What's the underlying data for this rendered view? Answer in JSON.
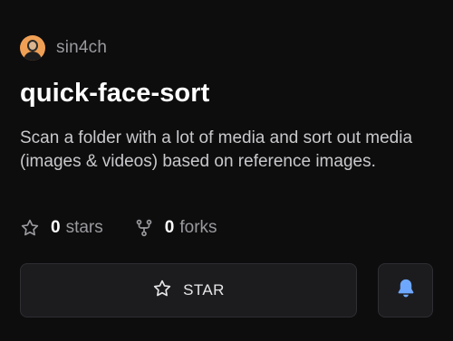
{
  "owner": {
    "name": "sin4ch",
    "avatar_icon": "user-avatar"
  },
  "repo": {
    "title": "quick-face-sort",
    "description": "Scan a folder with a lot of media and sort out media (images & videos) based on reference images."
  },
  "stats": {
    "stars": {
      "count": "0",
      "label": "stars",
      "icon": "star-outline-icon"
    },
    "forks": {
      "count": "0",
      "label": "forks",
      "icon": "fork-icon"
    }
  },
  "actions": {
    "star_label": "STAR",
    "star_icon": "star-outline-icon",
    "notify_icon": "bell-icon"
  },
  "colors": {
    "background": "#0d0d0e",
    "muted_text": "#9a9a9e",
    "button_bg": "#1c1c1f",
    "bell_accent": "#6ea8fe"
  }
}
